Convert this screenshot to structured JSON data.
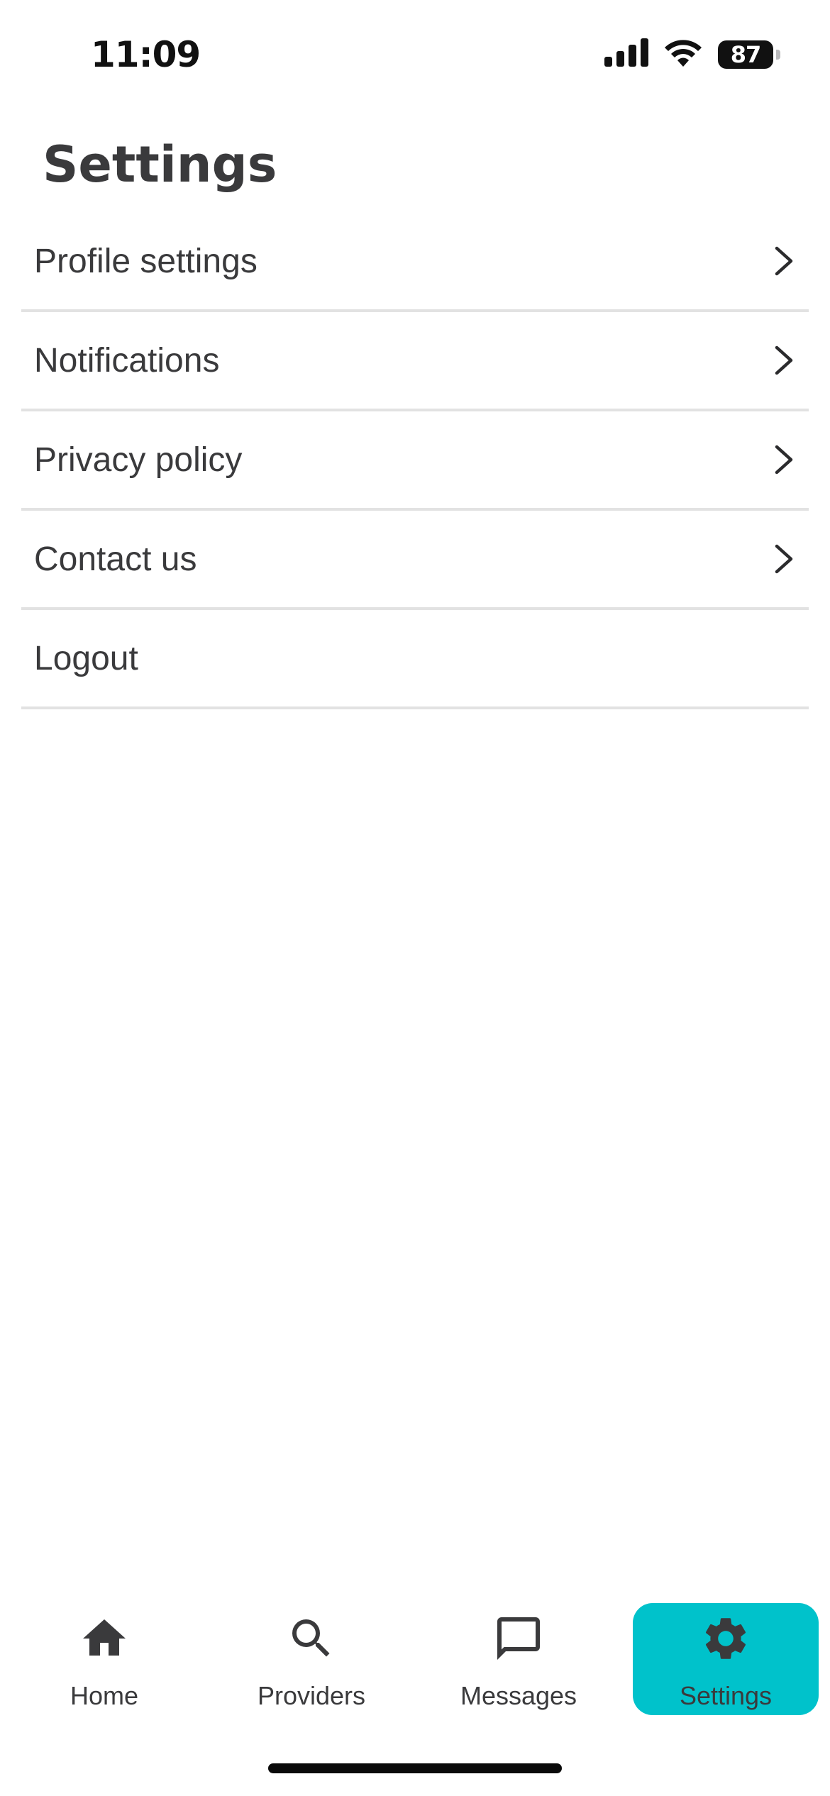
{
  "status_bar": {
    "time": "11:09",
    "battery_level": "87",
    "icons": [
      "cellular-signal-icon",
      "wifi-icon",
      "battery-icon"
    ]
  },
  "page": {
    "title": "Settings"
  },
  "settings": {
    "items": [
      {
        "label": "Profile settings",
        "has_chevron": true
      },
      {
        "label": "Notifications",
        "has_chevron": true
      },
      {
        "label": "Privacy policy",
        "has_chevron": true
      },
      {
        "label": "Contact us",
        "has_chevron": true
      },
      {
        "label": "Logout",
        "has_chevron": false
      }
    ]
  },
  "tab_bar": {
    "tabs": [
      {
        "label": "Home",
        "icon": "home-icon",
        "active": false
      },
      {
        "label": "Providers",
        "icon": "search-icon",
        "active": false
      },
      {
        "label": "Messages",
        "icon": "chat-bubble-icon",
        "active": false
      },
      {
        "label": "Settings",
        "icon": "gear-icon",
        "active": true
      }
    ]
  },
  "colors": {
    "accent": "#00c2cb",
    "text": "#3a3a3c",
    "divider": "#e2e2e2"
  }
}
